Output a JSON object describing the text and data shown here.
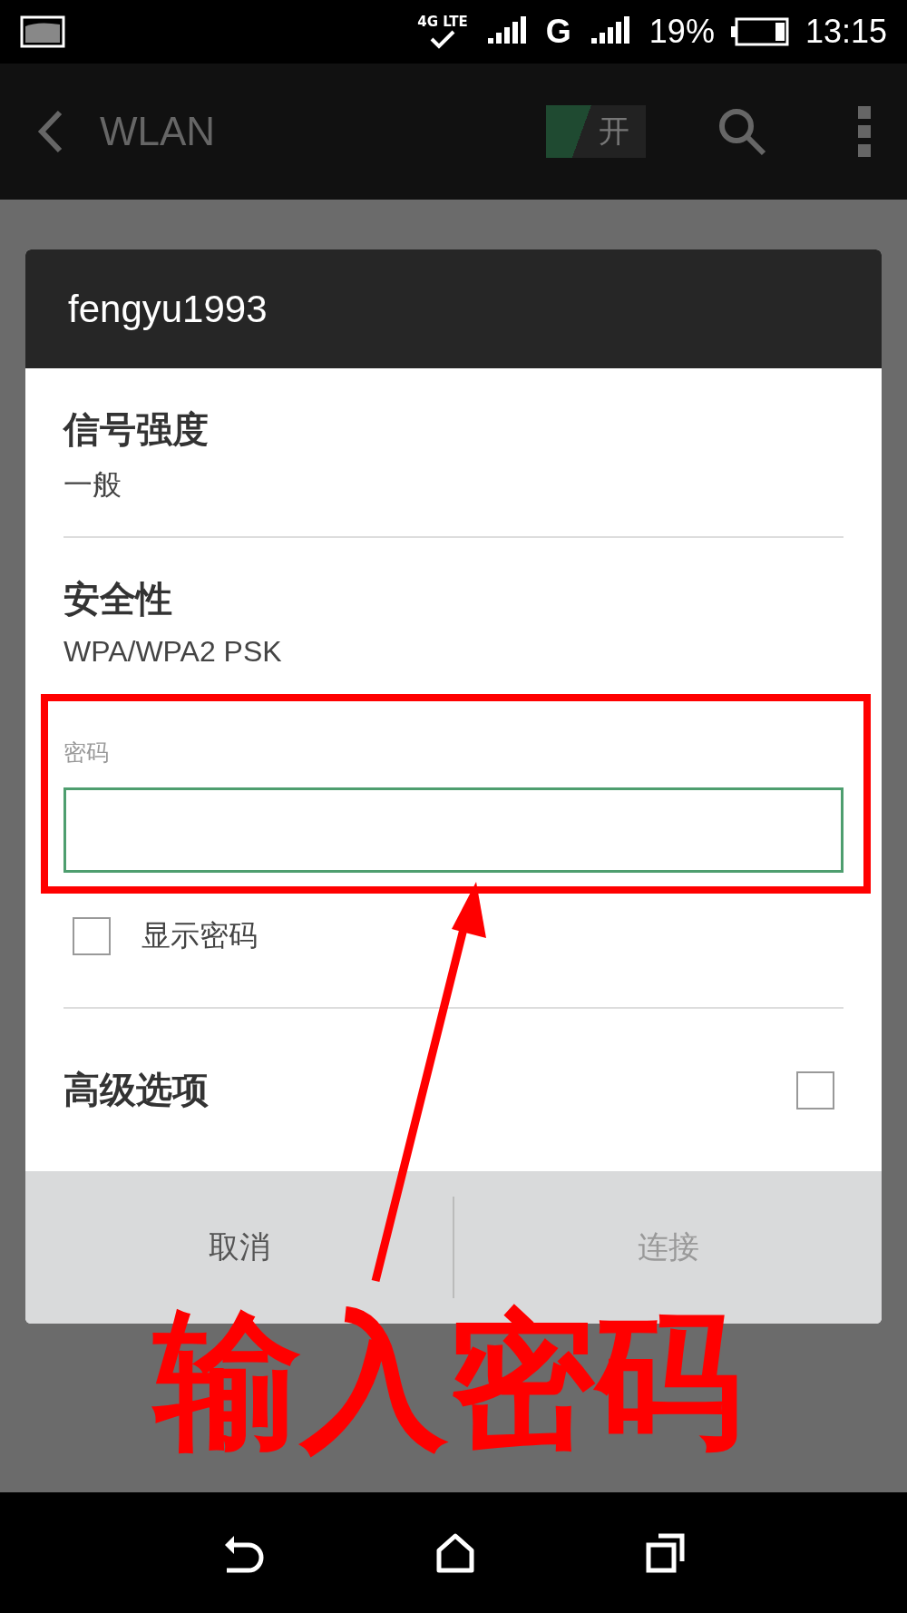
{
  "status_bar": {
    "network": "4G LTE",
    "network_2": "G",
    "battery": "19%",
    "time": "13:15"
  },
  "app_bar": {
    "title": "WLAN",
    "toggle": {
      "label": "开",
      "on": true
    }
  },
  "dialog": {
    "title": "fengyu1993",
    "info": [
      {
        "label": "信号强度",
        "value": "一般"
      },
      {
        "label": "安全性",
        "value": "WPA/WPA2 PSK"
      }
    ],
    "password": {
      "label": "密码",
      "focused": true
    },
    "show_password": {
      "label": "显示密码",
      "checked": false
    },
    "advanced": {
      "label": "高级选项",
      "checked": false
    },
    "buttons": [
      {
        "label": "取消",
        "disabled": false
      },
      {
        "label": "连接",
        "disabled": true
      }
    ]
  },
  "annotation": {
    "text": "输入密码"
  }
}
